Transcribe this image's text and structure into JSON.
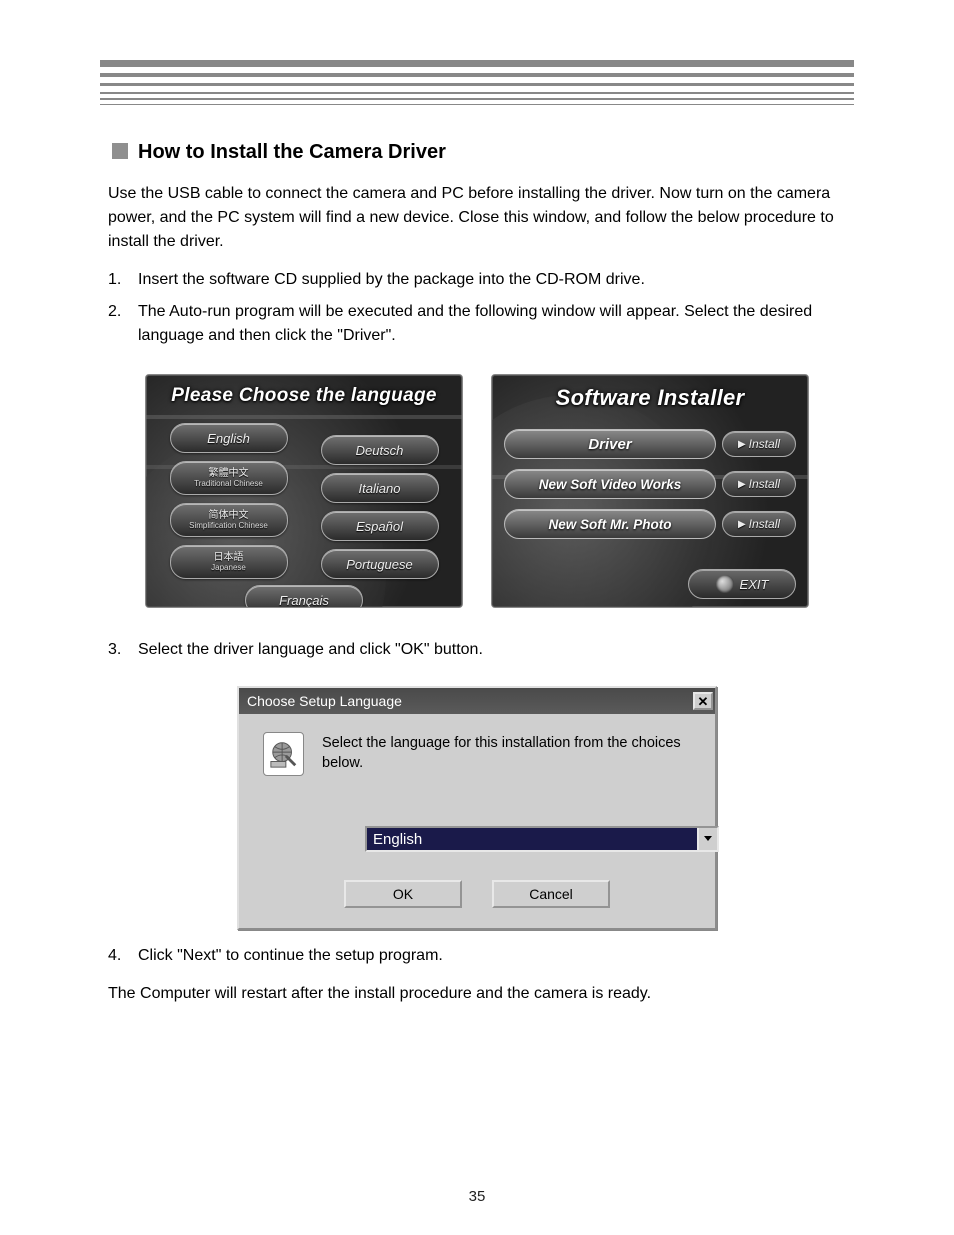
{
  "section": {
    "title": "How to Install the Camera Driver"
  },
  "paragraphs": {
    "intro": "Use the USB cable to connect the camera and PC before installing the driver. Now turn on the camera power, and the PC system will find a new device. Close this window, and follow the below procedure to install the driver.",
    "final": "The Computer will restart after the install procedure and the camera is ready."
  },
  "steps": {
    "s1_num": "1.",
    "s1_text": "Insert the software CD supplied by the package into the CD-ROM drive.",
    "s2_num": "2.",
    "s2_text": "The Auto-run program will be executed and the following window will appear. Select the desired language and then click the \"Driver\".",
    "s3_num": "3.",
    "s3_text": "Select the driver language and click \"OK\" button.",
    "s4_num": "4.",
    "s4_text": "Click \"Next\" to continue the setup program."
  },
  "langShot": {
    "header": "Please Choose the language",
    "left": {
      "english": "English",
      "tradcn_sub": "Traditional Chinese",
      "simpcn_sub": "Simplification Chinese",
      "jp_sub": "Japanese",
      "french": "Français"
    },
    "right": {
      "deutsch": "Deutsch",
      "italiano": "Italiano",
      "espanol": "Español",
      "portuguese": "Portuguese"
    }
  },
  "installerShot": {
    "header": "Software Installer",
    "rows": {
      "driver": "Driver",
      "video": "New Soft Video Works",
      "photo": "New Soft Mr. Photo"
    },
    "installLabel": "Install",
    "exitLabel": "EXIT"
  },
  "dialog": {
    "title": "Choose Setup Language",
    "message": "Select the language for this installation from the choices below.",
    "selected": "English",
    "ok": "OK",
    "cancel": "Cancel"
  },
  "pageNumber": "35"
}
